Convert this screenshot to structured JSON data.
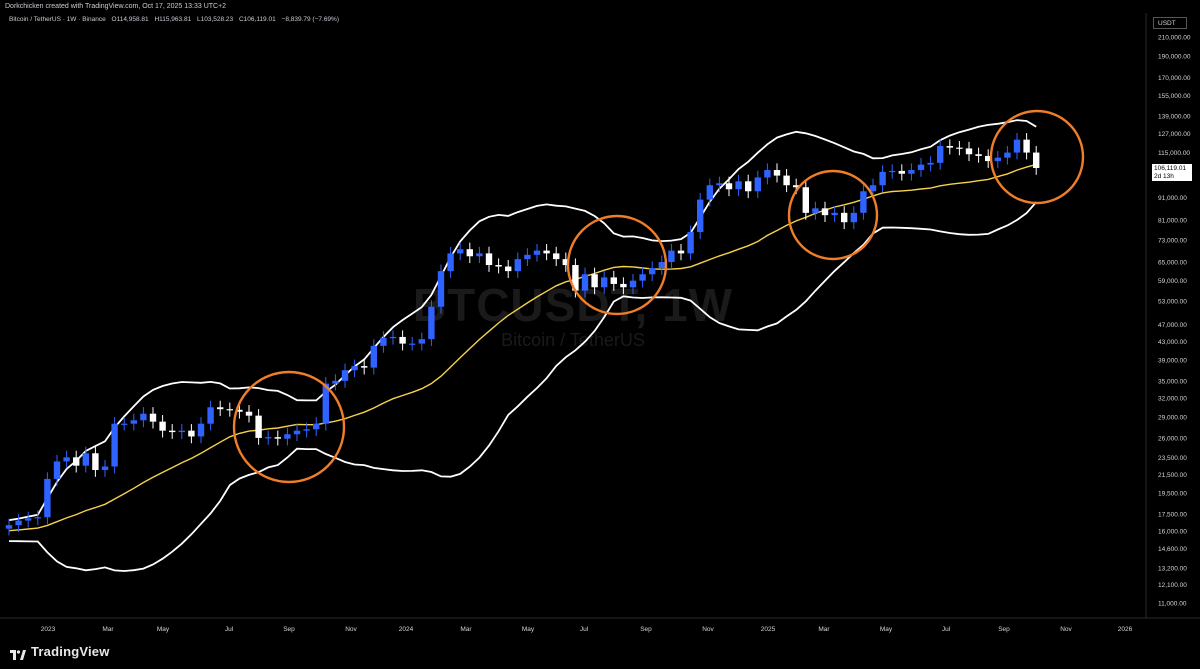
{
  "header": {
    "attribution": "Dorkchicken created with TradingView.com, Oct 17, 2025 13:33 UTC+2"
  },
  "legend": {
    "symbol": "Bitcoin / TetherUS · 1W · Binance",
    "open": "O114,958.81",
    "high": "H115,963.81",
    "low": "L103,528.23",
    "close": "C106,119.01",
    "change": "−8,839.79 (−7.69%)"
  },
  "watermark": {
    "symbol": "BTCUSDT, 1W",
    "name": "Bitcoin / TetherUS"
  },
  "price_axis": {
    "currency": "USDT",
    "last_price": "106,119.01",
    "countdown": "2d 13h"
  },
  "branding": {
    "name": "TradingView"
  },
  "colors": {
    "background": "#000000",
    "up_candle": "#2f62ff",
    "down_candle": "#ffffff",
    "basis": "#f5d24a",
    "bands": "#ffffff",
    "circles": "#f07d28",
    "axis_text": "#d1d4dc"
  },
  "chart_data": {
    "type": "candlestick",
    "interval": "1W",
    "scale": "log",
    "y_ticks": [
      210000,
      190000,
      170000,
      155000,
      139000,
      127000,
      115000,
      103000,
      91000,
      81000,
      73000,
      65000,
      59000,
      53000,
      47000,
      43000,
      39000,
      35000,
      32000,
      29000,
      26000,
      23500,
      21500,
      19500,
      17500,
      16000,
      14600,
      13200,
      12100,
      11000
    ],
    "y_tick_labels": [
      "210,000.00",
      "190,000.00",
      "170,000.00",
      "155,000.00",
      "139,000.00",
      "127,000.00",
      "115,000.00",
      "103,000.00",
      "91,000.00",
      "81,000.00",
      "73,000.00",
      "65,000.00",
      "59,000.00",
      "53,000.00",
      "47,000.00",
      "43,000.00",
      "39,000.00",
      "35,000.00",
      "32,000.00",
      "29,000.00",
      "26,000.00",
      "23,500.00",
      "21,500.00",
      "19,500.00",
      "17,500.00",
      "16,000.00",
      "14,600.00",
      "13,200.00",
      "12,100.00",
      "11,000.00"
    ],
    "x_ticks": [
      "2023",
      "Mar",
      "May",
      "Jul",
      "Sep",
      "Nov",
      "2024",
      "Mar",
      "May",
      "Jul",
      "Sep",
      "Nov",
      "2025",
      "Mar",
      "May",
      "Jul",
      "Sep",
      "Nov",
      "2026"
    ],
    "closes": [
      16500,
      16900,
      17100,
      17200,
      21000,
      23000,
      23500,
      22500,
      24000,
      22000,
      22400,
      28000,
      28000,
      28500,
      29500,
      28300,
      27000,
      26800,
      27000,
      26200,
      28000,
      30500,
      30200,
      30100,
      29800,
      29200,
      26000,
      26100,
      25900,
      26500,
      27000,
      27200,
      28000,
      34500,
      35000,
      37000,
      37800,
      37500,
      42000,
      43800,
      44000,
      42500,
      42500,
      43500,
      51500,
      62000,
      68000,
      69500,
      67000,
      68000,
      64000,
      63500,
      62000,
      66000,
      67500,
      69000,
      68000,
      66000,
      64000,
      56000,
      61000,
      57000,
      60000,
      58000,
      57000,
      59000,
      61000,
      63000,
      65000,
      69000,
      68000,
      76000,
      90000,
      97000,
      98000,
      95000,
      99000,
      94000,
      101000,
      105000,
      102000,
      97000,
      96000,
      84000,
      86000,
      83000,
      84000,
      80000,
      84000,
      94000,
      97000,
      104000,
      104500,
      103000,
      105000,
      108000,
      109000,
      119000,
      118000,
      117500,
      114000,
      113000,
      110000,
      112000,
      115000,
      123000,
      115000,
      106119
    ],
    "basis": "20-period SMA",
    "bands": "Bollinger Bands (20, 2)",
    "highlight_circles": 4
  }
}
